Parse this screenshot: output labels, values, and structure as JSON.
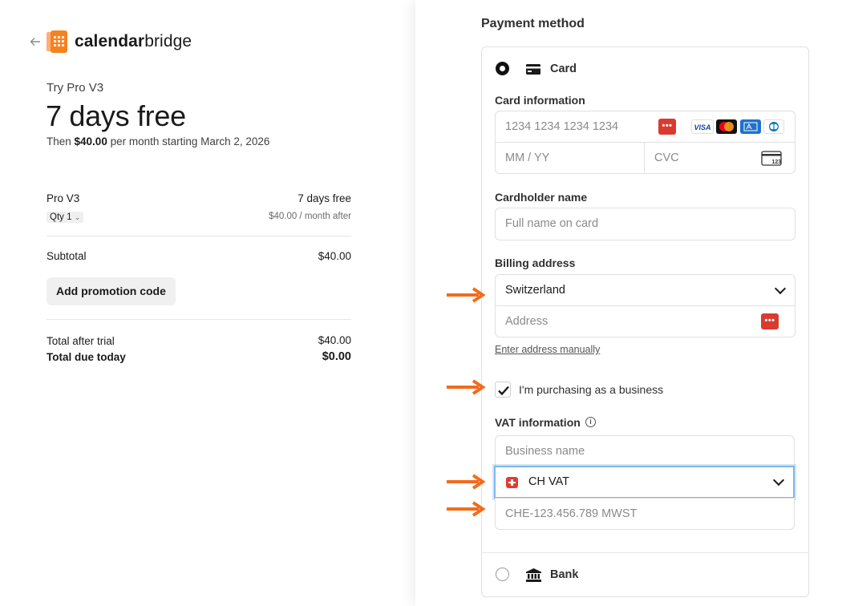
{
  "brand": {
    "name_bold": "calendar",
    "name_regular": "bridge"
  },
  "plan": {
    "try_label": "Try Pro V3",
    "headline": "7 days free",
    "then_prefix": "Then ",
    "then_price": "$40.00",
    "then_suffix": " per month starting March 2, 2026"
  },
  "line_item": {
    "name": "Pro V3",
    "qty_label": "Qty 1",
    "price": "7 days free",
    "price_after": "$40.00 / month after"
  },
  "summary": {
    "subtotal_label": "Subtotal",
    "subtotal_value": "$40.00",
    "promo_button": "Add promotion code",
    "after_trial_label": "Total after trial",
    "after_trial_value": "$40.00",
    "due_today_label": "Total due today",
    "due_today_value": "$0.00"
  },
  "payment": {
    "title": "Payment method",
    "card_option": "Card",
    "bank_option": "Bank",
    "card_info_label": "Card information",
    "card_number_placeholder": "1234 1234 1234 1234",
    "expiry_placeholder": "MM / YY",
    "cvc_placeholder": "CVC",
    "card_brands": [
      "VISA",
      "mastercard",
      "amex",
      "diners"
    ],
    "cardholder_label": "Cardholder name",
    "cardholder_placeholder": "Full name on card",
    "billing_label": "Billing address",
    "country_value": "Switzerland",
    "address_placeholder": "Address",
    "manual_link": "Enter address manually",
    "business_checkbox_label": "I'm purchasing as a business",
    "business_checked": true,
    "vat_label": "VAT information",
    "business_name_placeholder": "Business name",
    "vat_type_value": "CH VAT",
    "vat_number_placeholder": "CHE-123.456.789 MWST"
  },
  "colors": {
    "accent_arrow": "#f26b1d",
    "focus_border": "#7fb6e8",
    "password_manager": "#d93b30"
  },
  "icons": {
    "back": "arrow-left-icon",
    "card": "credit-card-icon",
    "bank": "bank-icon",
    "cvc": "cvc-card-icon",
    "info": "info-icon",
    "flag": "swiss-flag-icon"
  }
}
